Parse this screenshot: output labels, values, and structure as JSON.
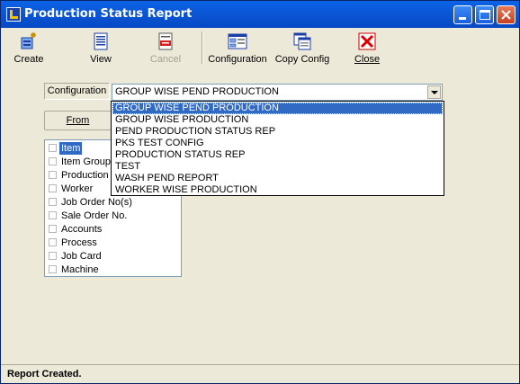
{
  "window": {
    "title": "Production Status Report"
  },
  "toolbar": {
    "create": "Create",
    "view": "View",
    "cancel": "Cancel",
    "configuration": "Configuration",
    "copy_config": "Copy Config",
    "close": "Close"
  },
  "config": {
    "label": "Configuration",
    "value": "GROUP WISE PEND PRODUCTION",
    "options": [
      "GROUP WISE PEND PRODUCTION",
      "GROUP WISE PRODUCTION",
      "PEND PRODUCTION STATUS REP",
      "PKS TEST CONFIG",
      "PRODUCTION STATUS REP",
      "TEST",
      "WASH PEND REPORT",
      "WORKER WISE PRODUCTION"
    ]
  },
  "from_button": "From",
  "fields": [
    "Item",
    "Item Group",
    "Production L",
    "Worker",
    "Job Order No(s)",
    "Sale Order No.",
    "Accounts",
    "Process",
    "Job Card",
    "Machine"
  ],
  "status": "Report Created."
}
